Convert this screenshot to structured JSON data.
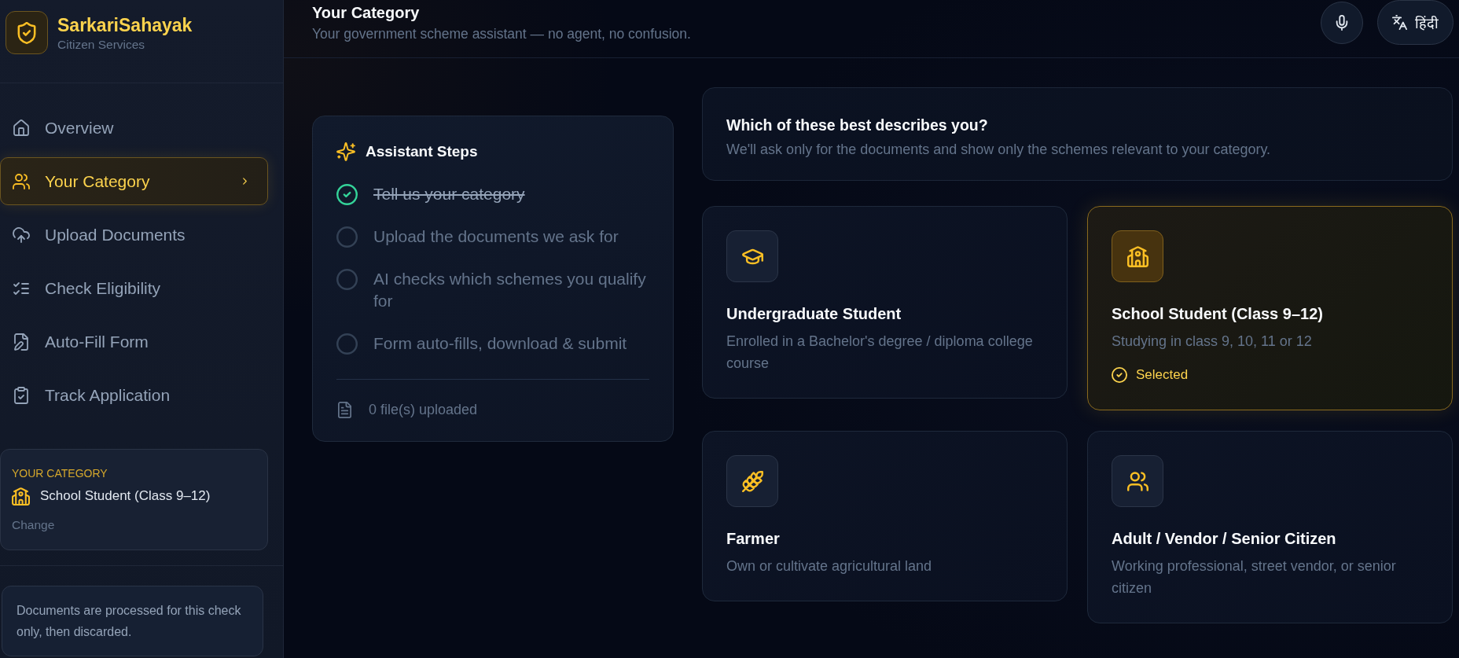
{
  "sidebar": {
    "brand": {
      "title": "SarkariSahayak",
      "subtitle": "Citizen Services"
    },
    "nav": [
      {
        "label": "Overview",
        "selected": false
      },
      {
        "label": "Your Category",
        "selected": true
      },
      {
        "label": "Upload Documents",
        "selected": false
      },
      {
        "label": "Check Eligibility",
        "selected": false
      },
      {
        "label": "Auto-Fill Form",
        "selected": false
      },
      {
        "label": "Track Application",
        "selected": false
      }
    ],
    "category_summary": {
      "label": "YOUR CATEGORY",
      "value": "School Student (Class 9–12)",
      "action": "Change"
    },
    "note": "Documents are processed for this check only, then discarded."
  },
  "header": {
    "title": "Your Category",
    "subtitle": "Your government scheme assistant — no agent, no confusion.",
    "language_button": "हिंदी"
  },
  "steps_card": {
    "title": "Assistant Steps",
    "steps": [
      {
        "label": "Tell us your category",
        "done": true
      },
      {
        "label": "Upload the documents we ask for",
        "done": false
      },
      {
        "label": "AI checks which schemes you qualify for",
        "done": false
      },
      {
        "label": "Form auto-fills, download & submit",
        "done": false
      }
    ],
    "footer": "0 file(s) uploaded"
  },
  "question": {
    "title": "Which of these best describes you?",
    "subtitle": "We'll ask only for the documents and show only the schemes relevant to your category."
  },
  "categories": {
    "selected_label": "Selected",
    "items": [
      {
        "title": "Undergraduate Student",
        "description": "Enrolled in a Bachelor's degree / diploma college course",
        "selected": false
      },
      {
        "title": "School Student (Class 9–12)",
        "description": "Studying in class 9, 10, 11 or 12",
        "selected": true
      },
      {
        "title": "Farmer",
        "description": "Own or cultivate agricultural land",
        "selected": false
      },
      {
        "title": "Adult / Vendor / Senior Citizen",
        "description": "Working professional, street vendor, or senior citizen",
        "selected": false
      }
    ]
  }
}
